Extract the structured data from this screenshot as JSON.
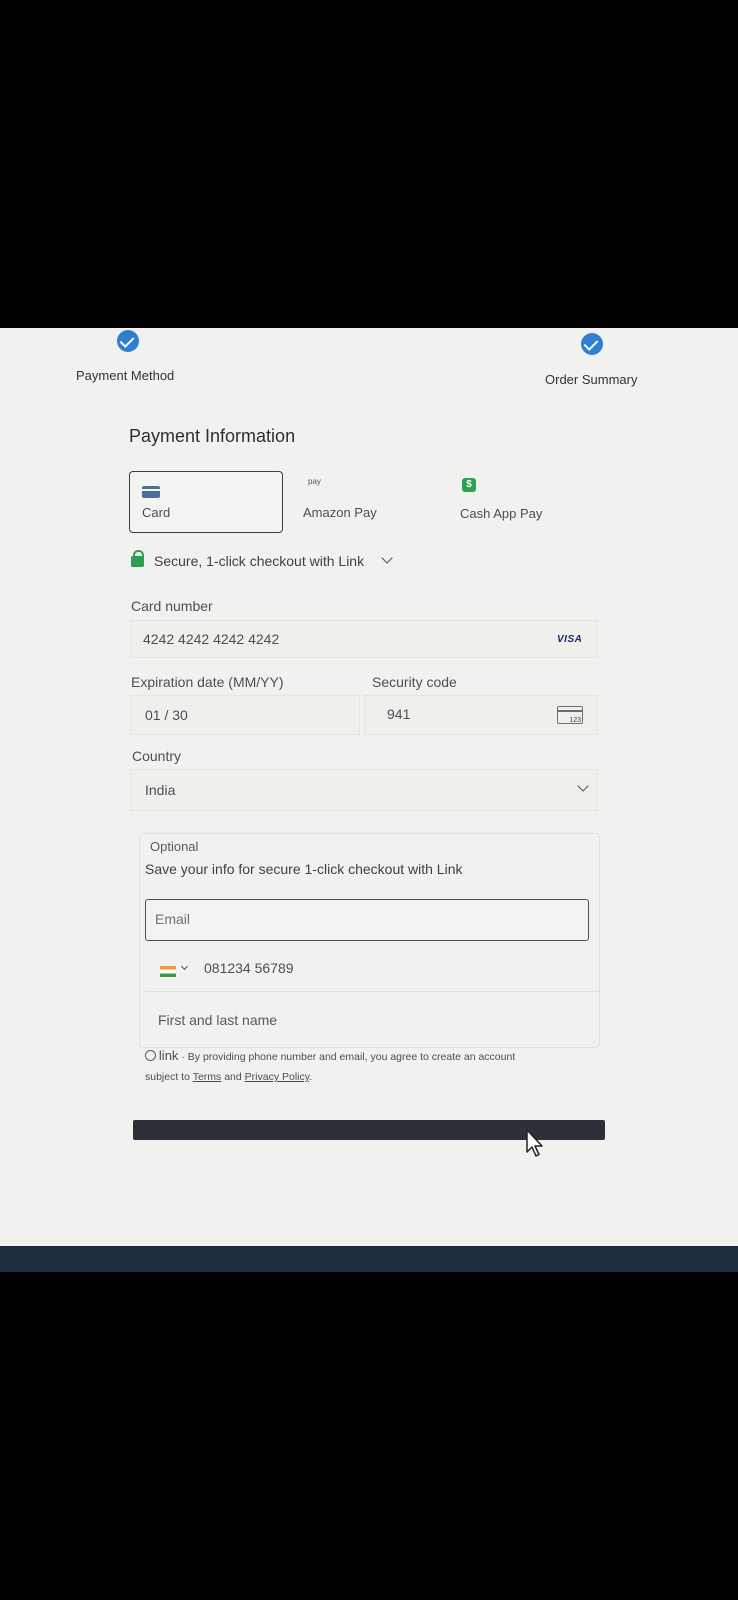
{
  "steps": {
    "left_label": "Payment Method",
    "right_label": "Order Summary"
  },
  "payment": {
    "title": "Payment Information",
    "tabs": [
      {
        "label": "Card",
        "icon": "card-icon",
        "selected": true
      },
      {
        "label": "Amazon Pay",
        "icon": "amazon-pay-icon",
        "icon_text": "pay",
        "selected": false
      },
      {
        "label": "Cash App Pay",
        "icon": "cash-app-icon",
        "icon_text": "$",
        "selected": false
      }
    ],
    "link_banner": "Secure, 1-click checkout with Link",
    "card_number": {
      "label": "Card number",
      "value": "4242 4242 4242 4242",
      "brand": "VISA"
    },
    "expiration": {
      "label": "Expiration date (MM/YY)",
      "value": "01 / 30"
    },
    "security": {
      "label": "Security code",
      "value": "941",
      "icon_text": "123"
    },
    "country": {
      "label": "Country",
      "value": "India"
    }
  },
  "link_save": {
    "optional": "Optional",
    "heading": "Save your info for secure 1-click checkout with Link",
    "email_placeholder": "Email",
    "phone_value": "081234 56789",
    "name_placeholder": "First and last name",
    "legal_brand": "link",
    "legal_text": "By providing phone number and email, you agree to create an account",
    "legal_subject": "subject to",
    "terms": "Terms",
    "and": "and",
    "privacy": "Privacy Policy",
    "period": "."
  },
  "colors": {
    "accent_blue": "#2f7fd0",
    "link_green": "#2f9d4f",
    "button_dark": "#2b3039"
  }
}
